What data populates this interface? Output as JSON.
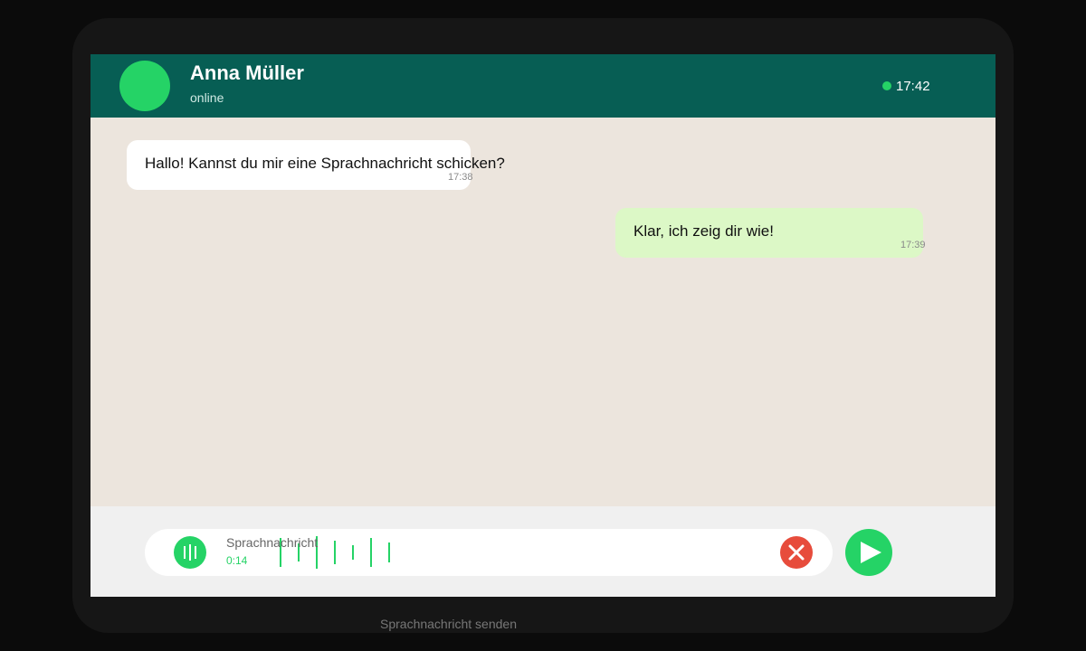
{
  "header": {
    "contact_name": "Anna Müller",
    "status": "online",
    "clock": "17:42"
  },
  "messages": [
    {
      "direction": "incoming",
      "text": "Hallo! Kannst du mir eine Sprachnachricht schicken?",
      "time": "17:38"
    },
    {
      "direction": "outgoing",
      "text": "Klar, ich zeig dir wie!",
      "time": "17:39"
    }
  ],
  "recorder": {
    "label": "Sprachnachricht",
    "duration": "0:14",
    "mic_icon": "mic-icon",
    "cancel_icon": "close-icon",
    "send_icon": "send-icon"
  },
  "caption": "Sprachnachricht senden",
  "colors": {
    "header": "#075e54",
    "accent": "#25d366",
    "chat_background": "#ece5dd",
    "incoming_bubble": "#ffffff",
    "outgoing_bubble": "#dcf8c6",
    "cancel": "#e74c3c"
  }
}
